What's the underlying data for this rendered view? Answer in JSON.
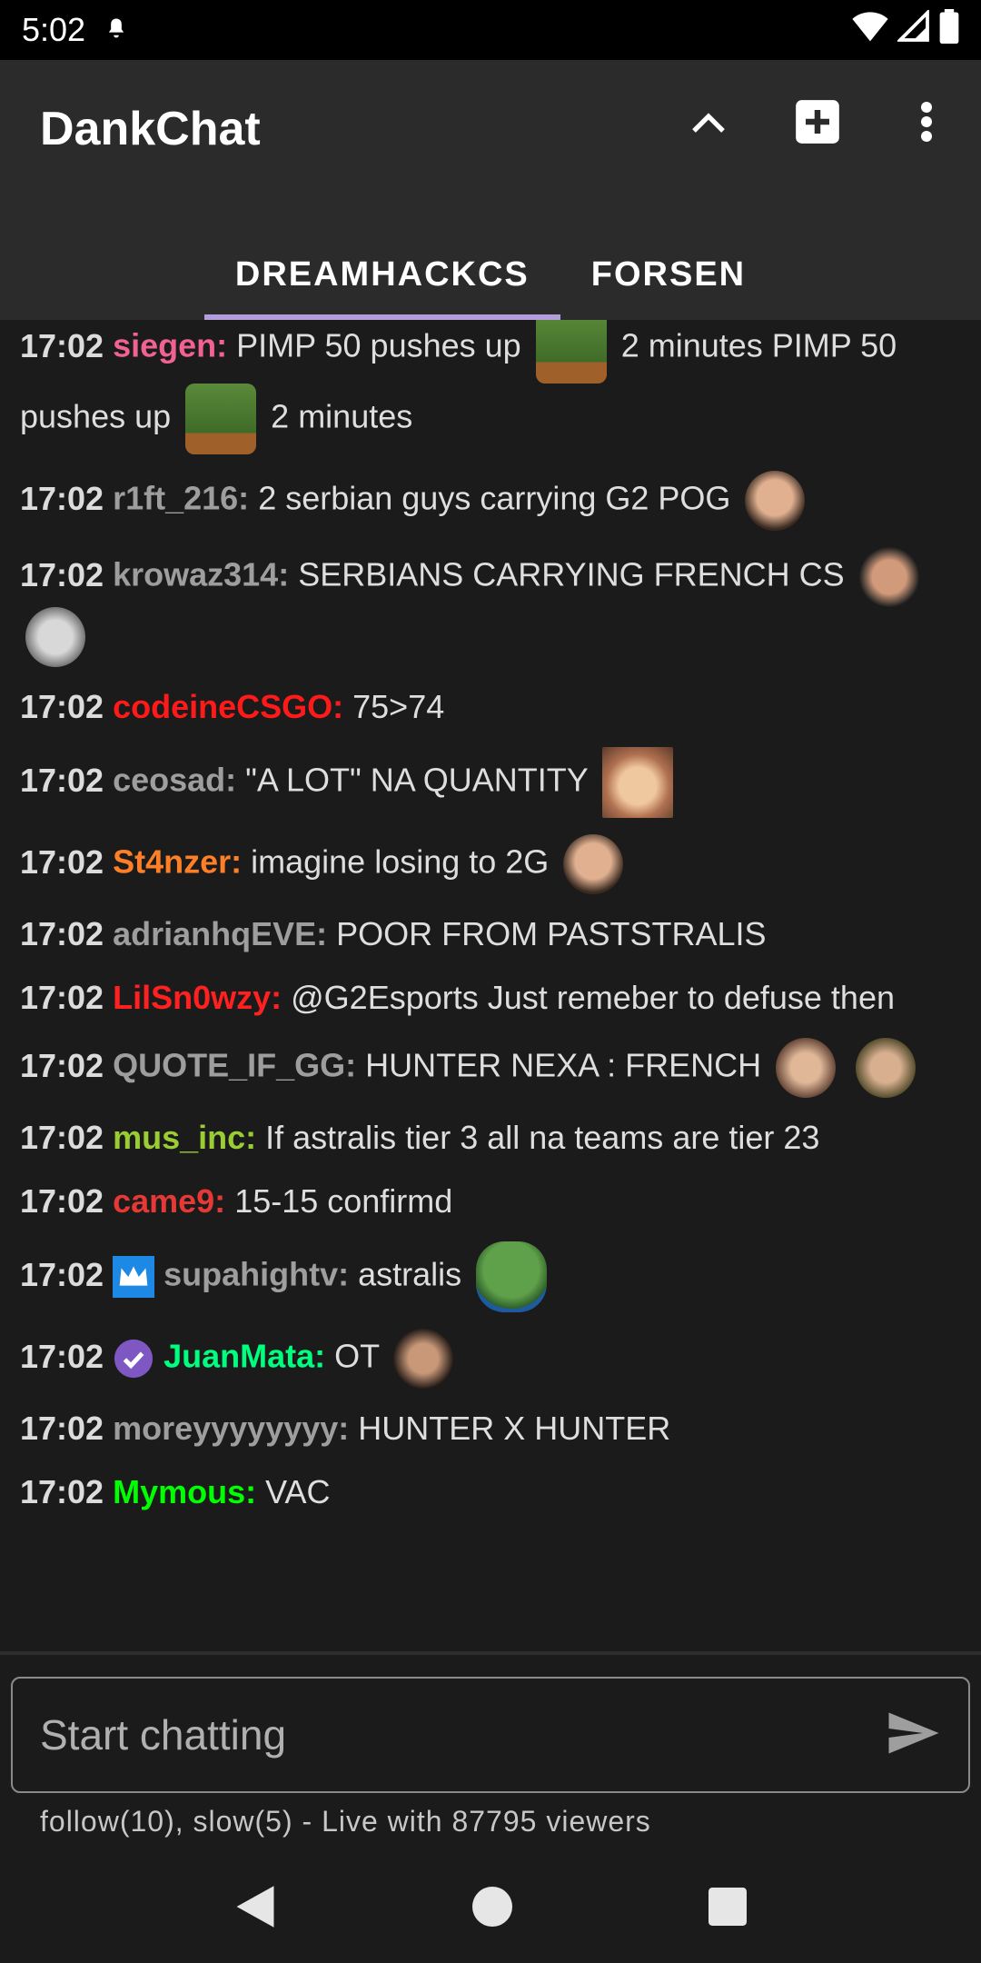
{
  "status": {
    "time": "5:02"
  },
  "app": {
    "title": "DankChat"
  },
  "tabs": [
    {
      "label": "DREAMHACKCS"
    },
    {
      "label": "FORSEN"
    }
  ],
  "messages": [
    {
      "time": "17:02",
      "user": "siegen:",
      "color": "#f06292",
      "text1": "PIMP 50 pushes up",
      "text2": "2 minutes PIMP 50 pushes up",
      "text3": "2 minutes"
    },
    {
      "time": "17:02",
      "user": "r1ft_216:",
      "color": "#9e9e9e",
      "text": "2 serbian guys carrying G2 POG"
    },
    {
      "time": "17:02",
      "user": "krowaz314:",
      "color": "#9e9e9e",
      "text": "SERBIANS CARRYING FRENCH CS"
    },
    {
      "time": "17:02",
      "user": "codeineCSGO:",
      "color": "#ff1a1a",
      "text": "75>74"
    },
    {
      "time": "17:02",
      "user": "ceosad:",
      "color": "#9e9e9e",
      "text": "\"A LOT\" NA QUANTITY"
    },
    {
      "time": "17:02",
      "user": "St4nzer:",
      "color": "#ff7f27",
      "text": "imagine losing to 2G"
    },
    {
      "time": "17:02",
      "user": "adrianhqEVE:",
      "color": "#9e9e9e",
      "text": "POOR FROM PASTSTRALIS"
    },
    {
      "time": "17:02",
      "user": "LilSn0wzy:",
      "color": "#ff2020",
      "text": "@G2Esports Just remeber to defuse then"
    },
    {
      "time": "17:02",
      "user": "QUOTE_IF_GG:",
      "color": "#9e9e9e",
      "text": "HUNTER NEXA : FRENCH"
    },
    {
      "time": "17:02",
      "user": "mus_inc:",
      "color": "#9acd32",
      "text": "If astralis tier 3 all na teams are tier 23"
    },
    {
      "time": "17:02",
      "user": "came9:",
      "color": "#e53935",
      "text": "15-15 confirmd"
    },
    {
      "time": "17:02",
      "user": "supahightv:",
      "color": "#9e9e9e",
      "text": "astralis"
    },
    {
      "time": "17:02",
      "user": "JuanMata:",
      "color": "#00ff7f",
      "text": "OT"
    },
    {
      "time": "17:02",
      "user": "moreyyyyyyyy:",
      "color": "#9e9e9e",
      "text": "HUNTER X HUNTER"
    },
    {
      "time": "17:02",
      "user": "Mymous:",
      "color": "#00ff00",
      "text": "VAC"
    }
  ],
  "input": {
    "placeholder": "Start chatting"
  },
  "footer": {
    "status": "follow(10), slow(5) - Live with 87795 viewers"
  }
}
